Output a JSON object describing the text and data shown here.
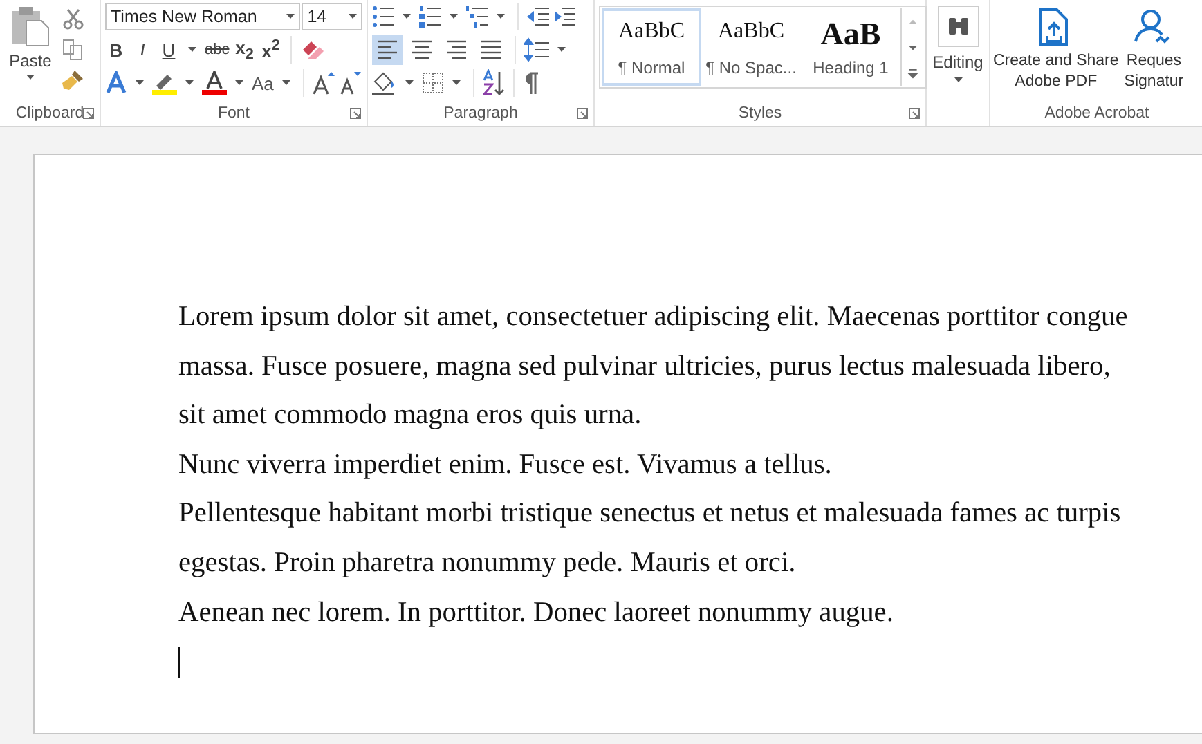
{
  "ribbon": {
    "clipboard": {
      "paste_label": "Paste",
      "group_label": "Clipboard"
    },
    "font": {
      "font_name": "Times New Roman",
      "font_size": "14",
      "format_buttons": [
        {
          "kind": "bold",
          "glyph": "B"
        },
        {
          "kind": "italic",
          "glyph": "I"
        },
        {
          "kind": "underline",
          "glyph": "U"
        },
        {
          "kind": "strike",
          "glyph": "abc"
        },
        {
          "kind": "subscript",
          "glyph": "x$_{2}$"
        },
        {
          "kind": "superscript",
          "glyph": "x$^{2}$"
        }
      ],
      "change_case": "Aa",
      "group_label": "Font"
    },
    "paragraph": {
      "alignment": [
        {
          "kind": "left",
          "selected": true
        },
        {
          "kind": "center",
          "selected": false
        },
        {
          "kind": "right",
          "selected": false
        },
        {
          "kind": "justify",
          "selected": false
        }
      ],
      "group_label": "Paragraph"
    },
    "styles": {
      "items": [
        {
          "kind": "normal",
          "preview": "AaBbC",
          "label": "¶ Normal",
          "selected": true
        },
        {
          "kind": "normal",
          "preview": "AaBbC",
          "label": "¶ No Spac...",
          "selected": false
        },
        {
          "kind": "heading",
          "preview": "AaB",
          "label": "Heading 1",
          "selected": false
        }
      ],
      "group_label": "Styles"
    },
    "editing": {
      "label": "Editing"
    },
    "acrobat": {
      "buttons": [
        {
          "kind": "share-pdf",
          "lines": [
            "Create and Share",
            "Adobe PDF"
          ]
        },
        {
          "kind": "signature",
          "lines": [
            "Reques",
            "Signatur"
          ]
        }
      ],
      "group_label": "Adobe Acrobat"
    }
  },
  "document": {
    "paragraphs": [
      "Lorem ipsum dolor sit amet, consectetuer adipiscing elit. Maecenas porttitor congue massa. Fusce posuere, magna sed pulvinar ultricies, purus lectus malesuada libero, sit amet commodo magna eros quis urna.",
      "Nunc viverra imperdiet enim. Fusce est. Vivamus a tellus.",
      "Pellentesque habitant morbi tristique senectus et netus et malesuada fames ac turpis egestas. Proin pharetra nonummy pede. Mauris et orci.",
      "Aenean nec lorem. In porttitor. Donec laoreet nonummy augue."
    ],
    "caret": true
  }
}
